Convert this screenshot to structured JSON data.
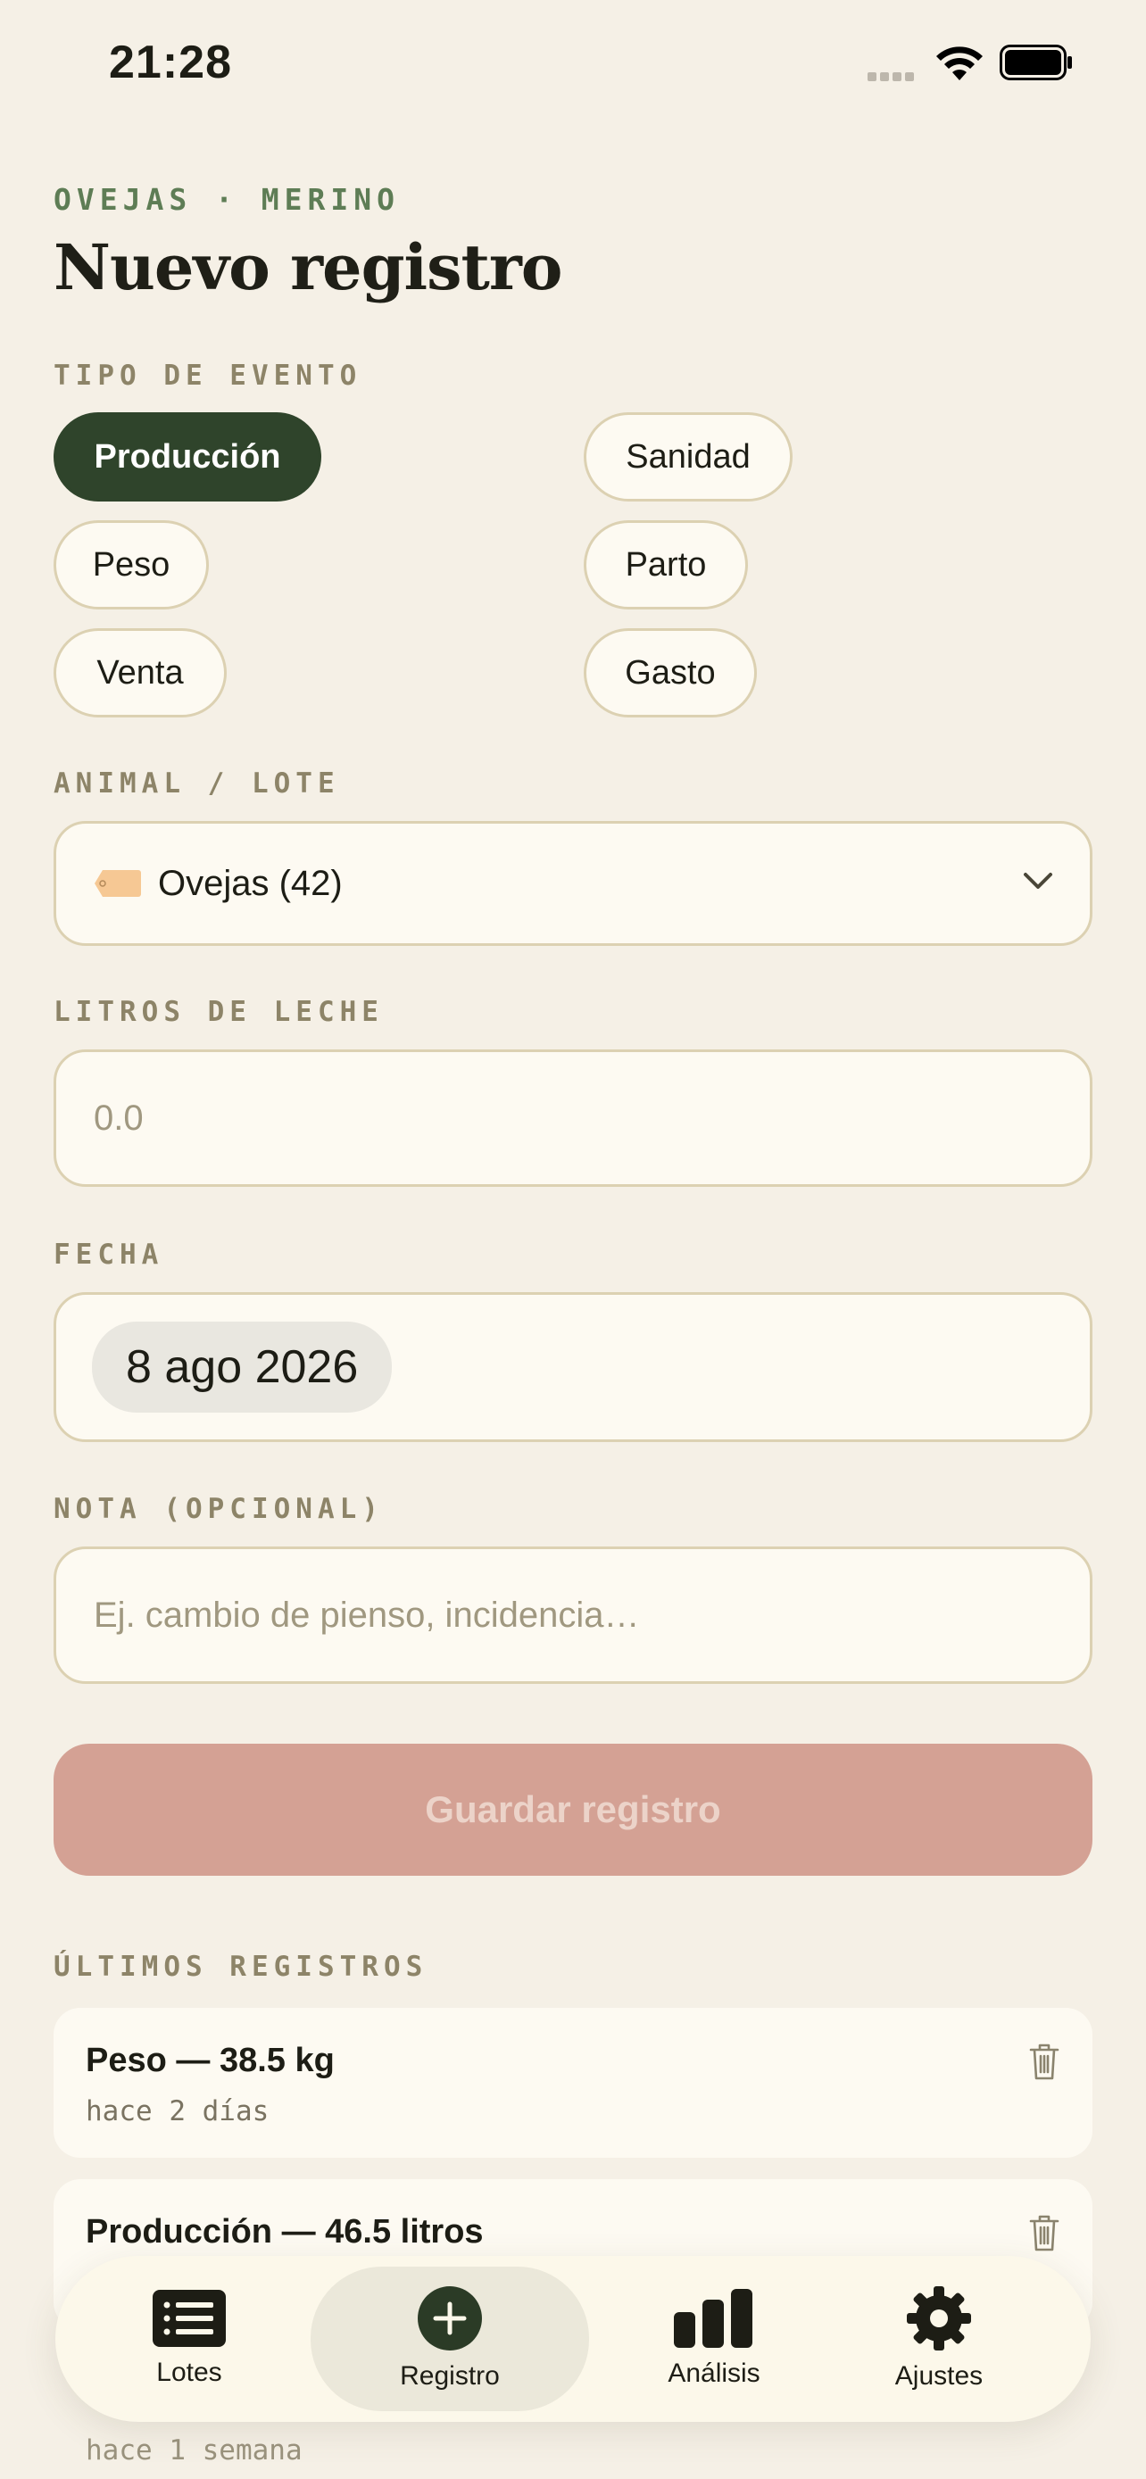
{
  "status_bar": {
    "time": "21:28"
  },
  "header": {
    "breadcrumb": "OVEJAS · MERINO",
    "title": "Nuevo registro"
  },
  "event_type": {
    "label": "TIPO DE EVENTO",
    "options": [
      "Producción",
      "Sanidad",
      "Peso",
      "Parto",
      "Venta",
      "Gasto"
    ],
    "selected": "Producción"
  },
  "animal": {
    "label": "ANIMAL / LOTE",
    "selected": "Ovejas (42)"
  },
  "liters": {
    "label": "LITROS DE LECHE",
    "placeholder": "0.0"
  },
  "date": {
    "label": "FECHA",
    "value": "8 ago 2026"
  },
  "note": {
    "label": "NOTA (OPCIONAL)",
    "placeholder": "Ej. cambio de pienso, incidencia…"
  },
  "save_label": "Guardar registro",
  "recent": {
    "label": "ÚLTIMOS REGISTROS",
    "items": [
      {
        "title": "Peso — 38.5 kg",
        "time": "hace 2 días"
      },
      {
        "title": "Producción — 46.5 litros",
        "time": ""
      },
      {
        "title": "",
        "time": "hace 1 semana"
      }
    ]
  },
  "tabs": [
    {
      "label": "Lotes",
      "icon": "list-icon"
    },
    {
      "label": "Registro",
      "icon": "plus-circle-icon"
    },
    {
      "label": "Análisis",
      "icon": "bar-chart-icon"
    },
    {
      "label": "Ajustes",
      "icon": "gear-icon"
    }
  ],
  "colors": {
    "background": "#f5f0e6",
    "accent_green": "#2f442b",
    "save_disabled": "#d4a194",
    "breadcrumb_green": "#5e7d55"
  }
}
